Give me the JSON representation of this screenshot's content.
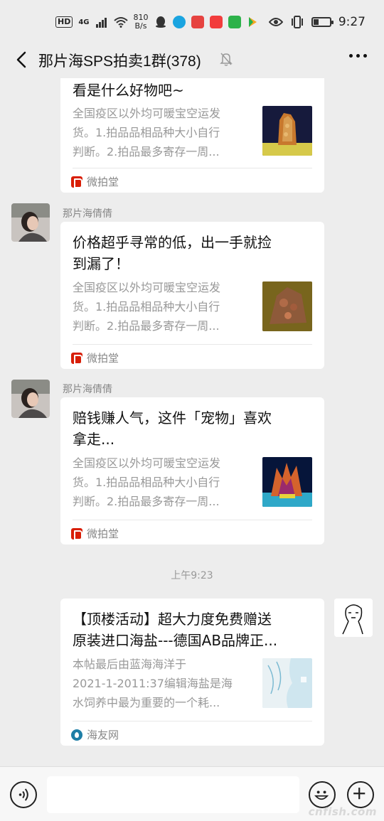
{
  "status_bar": {
    "hd": "HD",
    "network": "4G",
    "speed_value": "810",
    "speed_unit": "B/s",
    "time": "9:27"
  },
  "header": {
    "title": "那片海SPS拍卖1群(378)"
  },
  "messages": [
    {
      "type": "link-card",
      "title": "看是什么好物吧~",
      "desc_lines": [
        "全国疫区以外均可暖宝空运发",
        "货。1.拍品品相品种大小自行",
        "判断。2.拍品最多寄存一周..."
      ],
      "source": "微拍堂"
    },
    {
      "type": "link-card",
      "sender": "那片海倩倩",
      "title_lines": [
        "价格超乎寻常的低，出一手就捡",
        "到漏了！"
      ],
      "desc_lines": [
        "全国疫区以外均可暖宝空运发",
        "货。1.拍品品相品种大小自行",
        "判断。2.拍品最多寄存一周..."
      ],
      "source": "微拍堂"
    },
    {
      "type": "link-card",
      "sender": "那片海倩倩",
      "title_lines": [
        "赔钱赚人气，这件「宠物」喜欢",
        "拿走..."
      ],
      "desc_lines": [
        "全国疫区以外均可暖宝空运发",
        "货。1.拍品品相品种大小自行",
        "判断。2.拍品最多寄存一周..."
      ],
      "source": "微拍堂"
    },
    {
      "type": "timestamp",
      "text": "上午9:23"
    },
    {
      "type": "link-card-self",
      "title_lines": [
        "【顶楼活动】超大力度免费赠送",
        "原装进口海盐---德国AB品牌正..."
      ],
      "desc_lines": [
        "本帖最后由蓝海海洋于",
        "2021-1-2011:37编辑海盐是海",
        "水饲养中最为重要的一个耗..."
      ],
      "source": "海友网"
    }
  ],
  "watermark": "cnfish.com",
  "colors": {
    "background": "#ededed",
    "card": "#ffffff",
    "source_red": "#d81e06",
    "desc_gray": "#999999"
  }
}
